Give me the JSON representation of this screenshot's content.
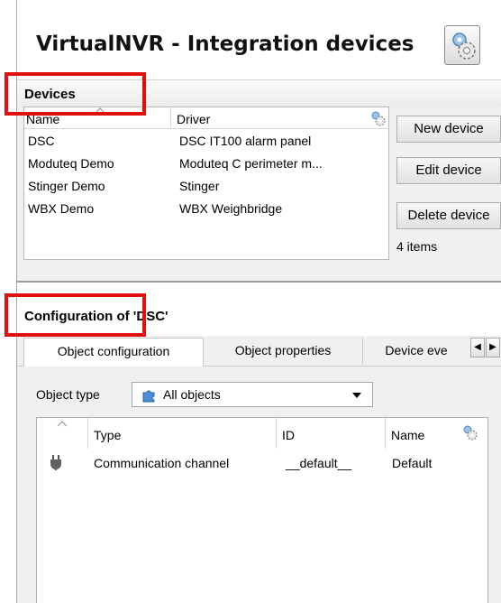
{
  "window": {
    "title": "VirtualNVR - Integration devices",
    "settings_icon": "gear-icon"
  },
  "devices_section": {
    "title": "Devices",
    "columns": [
      "Name",
      "Driver"
    ],
    "rows": [
      {
        "name": "DSC",
        "driver": "DSC IT100 alarm panel"
      },
      {
        "name": "Moduteq Demo",
        "driver": "Moduteq C perimeter m..."
      },
      {
        "name": "Stinger Demo",
        "driver": "Stinger"
      },
      {
        "name": "WBX Demo",
        "driver": "WBX Weighbridge"
      }
    ],
    "buttons": {
      "new": "New device",
      "edit": "Edit device",
      "delete": "Delete device"
    },
    "count": "4 items"
  },
  "config_section": {
    "title": "Configuration of 'DSC'",
    "tabs": [
      "Object configuration",
      "Object properties",
      "Device eve"
    ],
    "active_tab": "Object configuration",
    "object_type_label": "Object type",
    "object_type_value": "All objects",
    "columns": [
      "Type",
      "ID",
      "Name"
    ],
    "rows": [
      {
        "icon": "plug-icon",
        "type": "Communication channel",
        "id": "__default__",
        "name": "Default"
      }
    ]
  },
  "highlight_color": "#e01010"
}
